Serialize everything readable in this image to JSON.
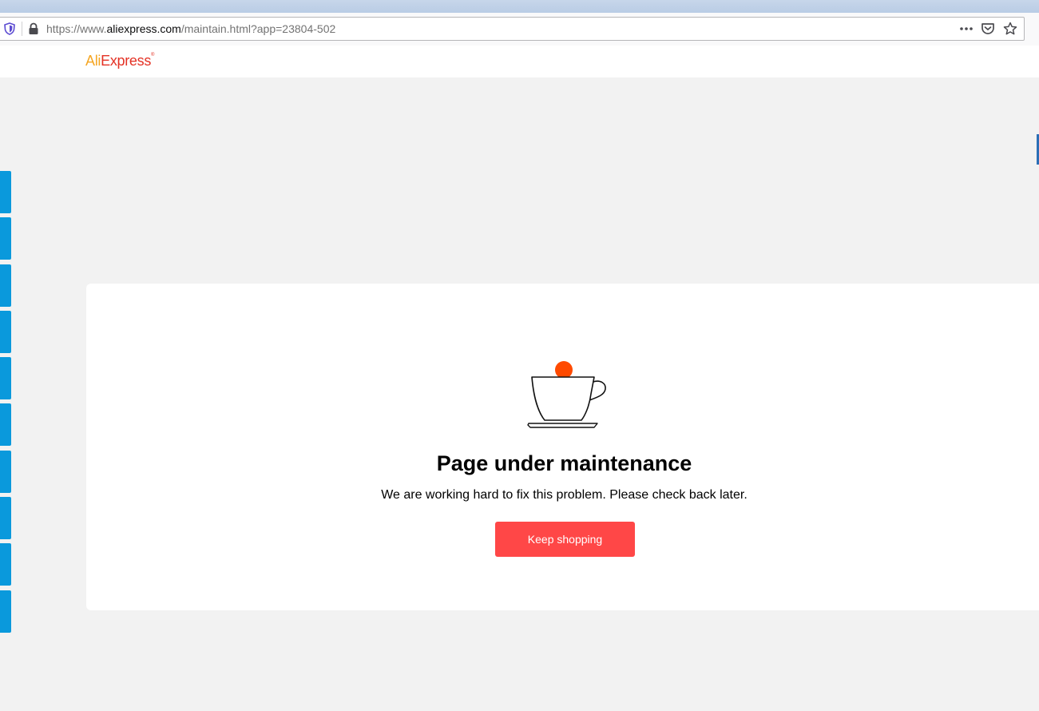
{
  "browser": {
    "url_prefix": "https://www.",
    "url_domain": "aliexpress.com",
    "url_path": "/maintain.html?app=23804-502",
    "icons": [
      "shield-icon",
      "lock-icon",
      "more-icon",
      "pocket-icon",
      "star-icon"
    ]
  },
  "header": {
    "logo_part1": "Ali",
    "logo_part2": "Express",
    "logo_mark": "®"
  },
  "main": {
    "illustration": "coffee-cup-icon",
    "title": "Page under maintenance",
    "message": "We are working hard to fix this problem. Please check back later.",
    "button_label": "Keep shopping"
  },
  "colors": {
    "accent": "#ff4747",
    "side_tab": "#0a99dc",
    "cup_dot": "#ff4a00"
  }
}
